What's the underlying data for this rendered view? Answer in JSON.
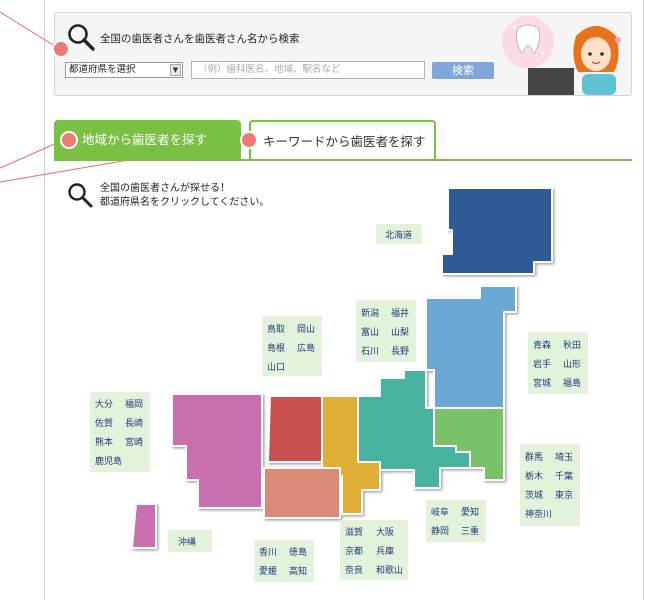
{
  "search": {
    "title": "全国の歯医者さんを歯医者さん名から検索",
    "prefecture_select": "都道府県を選択",
    "keyword_placeholder": "（例）歯科医名、地域、駅名など",
    "button": "検索"
  },
  "tabs": [
    {
      "label": "地域から歯医者を探す",
      "active": true
    },
    {
      "label": "キーワードから歯医者を探す",
      "active": false
    }
  ],
  "lead": {
    "line1": "全国の歯医者さんが探せる！",
    "line2": "都道府県名をクリックしてください。"
  },
  "regions": {
    "hokkaido": [
      "北海道"
    ],
    "tohoku": [
      "青森",
      "秋田",
      "岩手",
      "山形",
      "宮城",
      "福島"
    ],
    "hokuriku": [
      "新潟",
      "福井",
      "富山",
      "山梨",
      "石川",
      "長野"
    ],
    "chugoku": [
      "鳥取",
      "岡山",
      "島根",
      "広島",
      "山口"
    ],
    "kyushu": [
      "大分",
      "福岡",
      "佐賀",
      "長崎",
      "熊本",
      "宮崎",
      "鹿児島"
    ],
    "kanto": [
      "群馬",
      "埼玉",
      "栃木",
      "千葉",
      "茨城",
      "東京",
      "神奈川"
    ],
    "tokai": [
      "岐阜",
      "愛知",
      "静岡",
      "三重"
    ],
    "kinki": [
      "滋賀",
      "大阪",
      "京都",
      "兵庫",
      "奈良",
      "和歌山"
    ],
    "shikoku": [
      "香川",
      "徳島",
      "愛媛",
      "高知"
    ],
    "okinawa": [
      "沖縄"
    ]
  },
  "colors": {
    "tab_green": "#7ac143",
    "accent_dot": "#f07877",
    "button_blue": "#7fa6d9",
    "region_label_bg": "#e3f2da",
    "hokkaido": "#2f5a96",
    "tohoku": "#6aa7d2",
    "kanto": "#7ac26a",
    "chubu": "#46b29d",
    "kinki": "#e0ad35",
    "chugoku": "#c8514f",
    "shikoku": "#d98a74",
    "kyushu": "#c870ad"
  }
}
